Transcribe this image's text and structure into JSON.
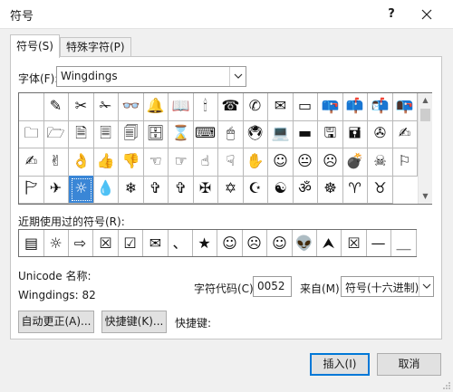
{
  "window": {
    "title": "符号",
    "help": "?"
  },
  "tabs": [
    {
      "label": "符号(S)"
    },
    {
      "label": "特殊字符(P)"
    }
  ],
  "font": {
    "label": "字体(F):",
    "value": "Wingdings"
  },
  "symbols": [
    "",
    "✎",
    "✂",
    "✁",
    "👓",
    "🔔",
    "📖",
    "🕯",
    "☎",
    "✆",
    "✉",
    "▭",
    "📪",
    "📫",
    "📬",
    "📭",
    "🗀",
    "🗁",
    "🗎",
    "🗏",
    "🗐",
    "🗄",
    "⌛",
    "⌨",
    "🖱",
    "🖲",
    "💻",
    "▬",
    "🖫",
    "🖬",
    "✇",
    "✍",
    "✍",
    "✌",
    "👌",
    "👍",
    "👎",
    "☜",
    "☞",
    "☝",
    "☟",
    "✋",
    "☺",
    "😐",
    "☹",
    "💣",
    "☠",
    "⚐",
    "🏱",
    "✈",
    "☼",
    "💧",
    "❄",
    "✞",
    "✞",
    "✠",
    "✡",
    "☪",
    "☯",
    "ॐ",
    "☸",
    "♈",
    "♉"
  ],
  "recent": {
    "label": "近期使用过的符号(R):",
    "items": [
      "▤",
      "☼",
      "⇨",
      "☒",
      "☑",
      "✉",
      "、",
      "★",
      "☺",
      "☹",
      "☺",
      "👽",
      "⮝",
      "☒",
      "—",
      "＿"
    ]
  },
  "unicode_name_label": "Unicode 名称:",
  "unicode_name_value": "Wingdings: 82",
  "char_code": {
    "label": "字符代码(C):",
    "value": "0052"
  },
  "from": {
    "label": "来自(M):",
    "value": "符号(十六进制)"
  },
  "buttons": {
    "autocorrect": "自动更正(A)...",
    "shortcut_key": "快捷键(K)...",
    "shortcut_key_label": "快捷键:",
    "insert": "插入(I)",
    "cancel": "取消"
  }
}
